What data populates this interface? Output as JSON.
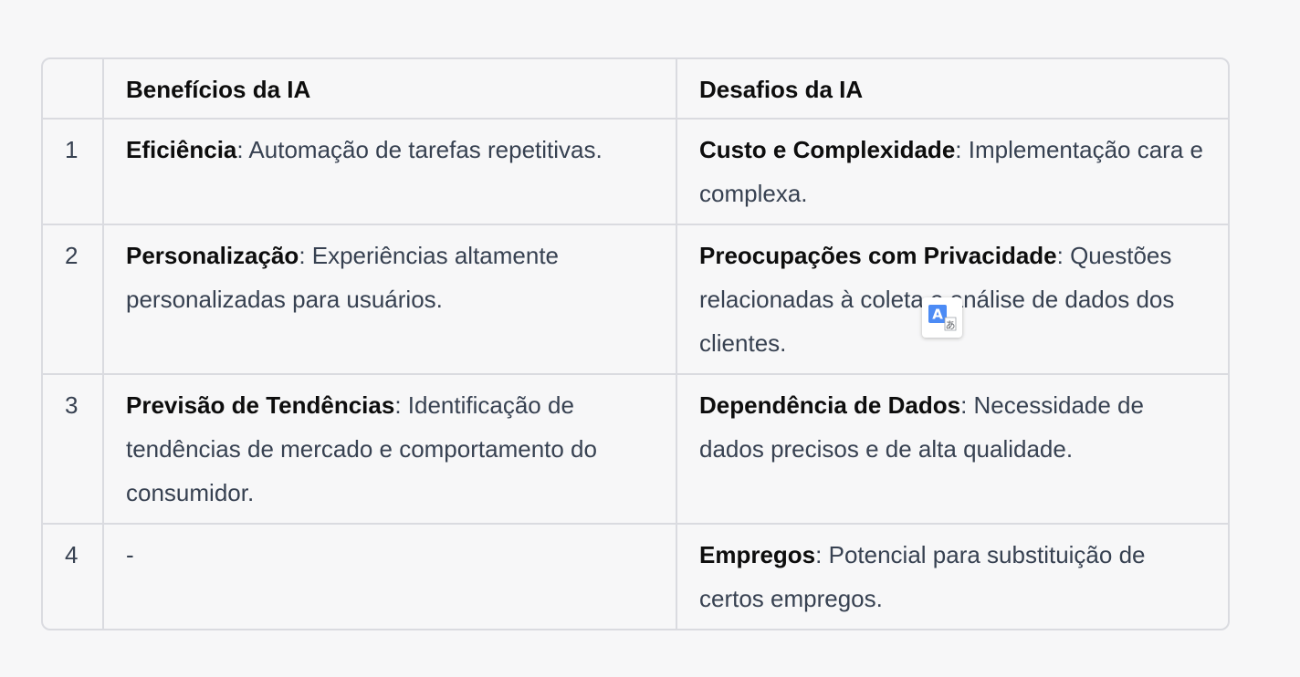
{
  "table": {
    "headers": {
      "number": "",
      "benefits": "Benefícios da IA",
      "challenges": "Desafios da IA"
    },
    "rows": [
      {
        "number": "1",
        "benefit_term": "Eficiência",
        "benefit_text": ": Automação de tarefas repetitivas.",
        "challenge_term": "Custo e Complexidade",
        "challenge_text": ": Implementação cara e complexa."
      },
      {
        "number": "2",
        "benefit_term": "Personalização",
        "benefit_text": ": Experiências altamente personalizadas para usuários.",
        "challenge_term": "Preocupações com Privacidade",
        "challenge_text": ": Questões relacionadas à coleta e análise de dados dos clientes."
      },
      {
        "number": "3",
        "benefit_term": "Previsão de Tendências",
        "benefit_text": ": Identificação de tendências de mercado e comportamento do consumidor.",
        "challenge_term": "Dependência de Dados",
        "challenge_text": ": Necessidade de dados precisos e de alta qualidade."
      },
      {
        "number": "4",
        "benefit_term": "",
        "benefit_text": "-",
        "challenge_term": "Empregos",
        "challenge_text": ": Potencial para substituição de certos empregos."
      }
    ]
  },
  "translate_popup": {
    "icon": "translate-icon",
    "accent_color": "#4c8bf5"
  }
}
